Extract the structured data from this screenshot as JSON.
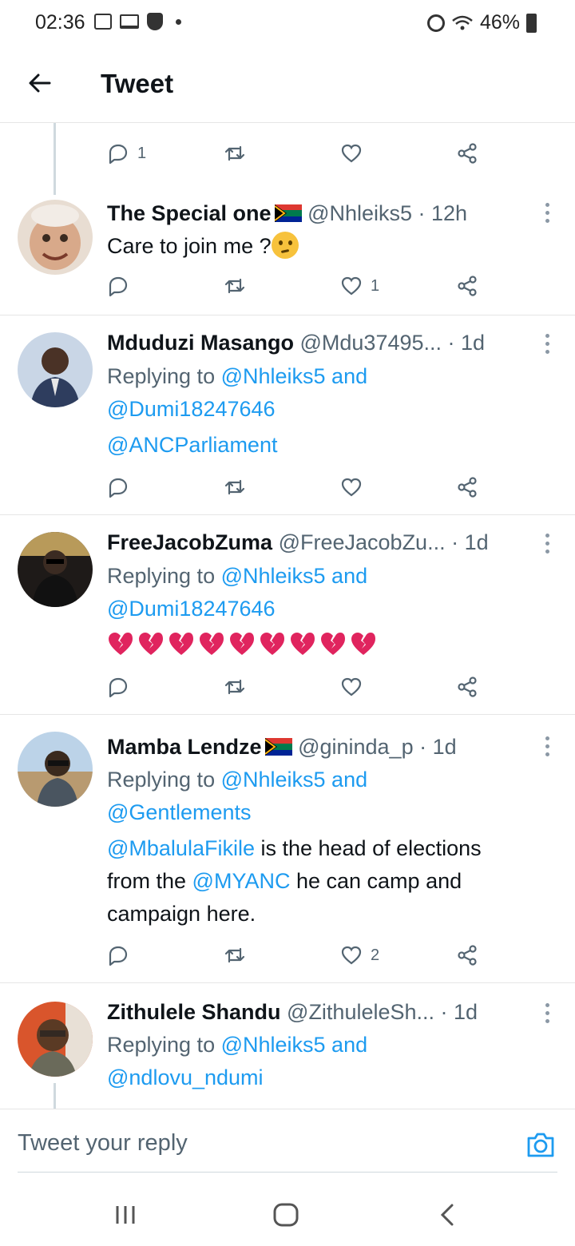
{
  "status_bar": {
    "time": "02:36",
    "battery": "46%"
  },
  "header": {
    "title": "Tweet"
  },
  "thread_top": {
    "reply_count": "1"
  },
  "tweets": [
    {
      "name": "The Special one",
      "handle": "@Nhleiks5 · 12h",
      "text": "Care to join me ?",
      "like_count": "1",
      "avatar_color": "#d9c2b0"
    },
    {
      "name": "Mduduzi Masango",
      "handle": "@Mdu37495... · 1d",
      "replying_prefix": "Replying to ",
      "replying_to": "@Nhleiks5 and",
      "replying_to_2": "@Dumi18247646",
      "text": "@ANCParliament",
      "avatar_color": "#3a4a6b"
    },
    {
      "name": "FreeJacobZuma",
      "handle": "@FreeJacobZu... · 1d",
      "replying_prefix": "Replying to ",
      "replying_to": "@Nhleiks5 and",
      "replying_to_2": "@Dumi18247646",
      "avatar_color": "#2a2420"
    },
    {
      "name": "Mamba Lendze",
      "handle": "@gininda_p · 1d",
      "replying_prefix": "Replying to ",
      "replying_to": "@Nhleiks5 and",
      "replying_to_2": "@Gentlements",
      "text_mention_1": "@MbalulaFikile",
      "text_part_1": " is the head of elections",
      "text_part_2": "from the ",
      "text_mention_2": "@MYANC",
      "text_part_3": " he can camp and",
      "text_part_4": "campaign here.",
      "like_count": "2",
      "avatar_color": "#8a7a60"
    },
    {
      "name": "Zithulele Shandu",
      "handle": "@ZithuleleSh... · 1d",
      "replying_prefix": "Replying to ",
      "replying_to": "@Nhleiks5 and",
      "replying_to_2": "@ndlovu_ndumi",
      "avatar_color": "#6b4a30"
    }
  ],
  "reply_bar": {
    "placeholder": "Tweet your reply"
  },
  "colors": {
    "link": "#1d9bf0",
    "muted": "#536471",
    "heart_broken": "#e0245e"
  }
}
